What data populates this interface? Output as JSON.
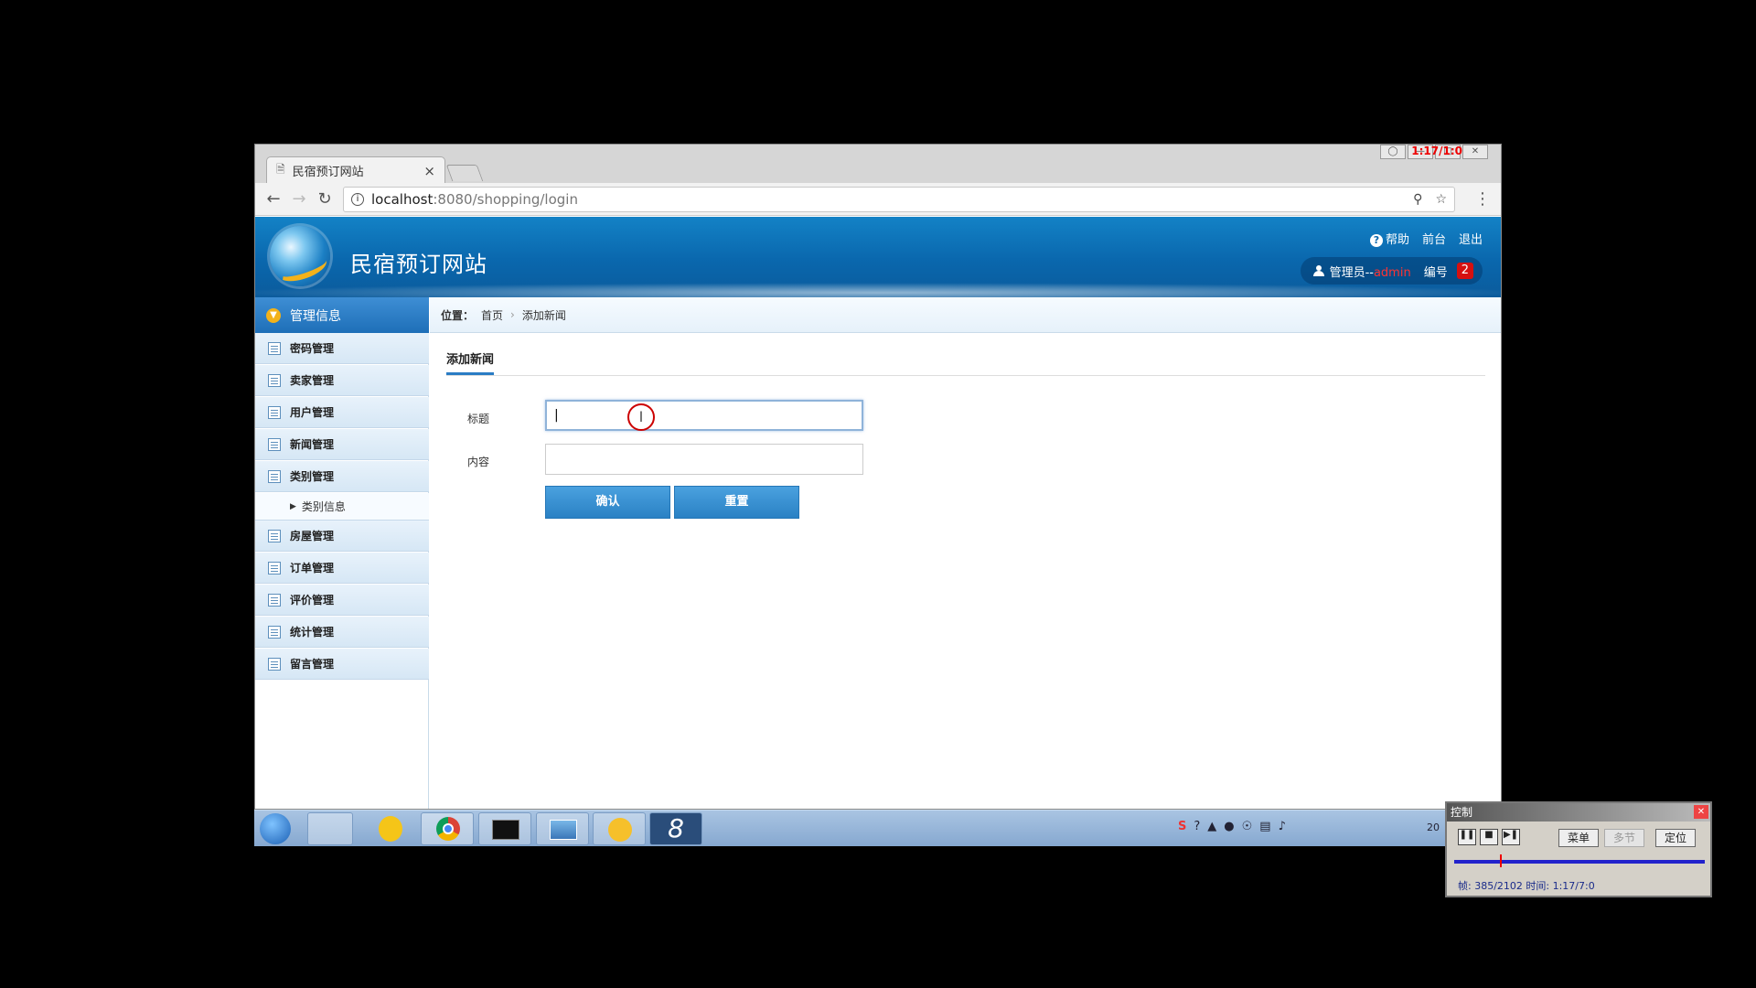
{
  "browser": {
    "tab_title": "民宿预订网站",
    "tab_close": "×",
    "url_host": "localhost",
    "url_path": ":8080/shopping/login",
    "overlay_text": "1:17/1:0"
  },
  "header": {
    "site_name": "民宿预订网站",
    "help": "帮助",
    "front": "前台",
    "logout": "退出",
    "user_prefix": "管理员--",
    "user_name": "admin",
    "id_label": "编号",
    "id_value": "2"
  },
  "sidebar": {
    "title": "管理信息",
    "items": [
      {
        "label": "密码管理"
      },
      {
        "label": "卖家管理"
      },
      {
        "label": "用户管理"
      },
      {
        "label": "新闻管理"
      },
      {
        "label": "类别管理"
      },
      {
        "label": "房屋管理"
      },
      {
        "label": "订单管理"
      },
      {
        "label": "评价管理"
      },
      {
        "label": "统计管理"
      },
      {
        "label": "留言管理"
      }
    ],
    "sub_item": "类别信息"
  },
  "breadcrumb": {
    "label": "位置：",
    "home": "首页",
    "current": "添加新闻"
  },
  "form": {
    "heading": "添加新闻",
    "title_label": "标题",
    "title_value": "|",
    "content_label": "内容",
    "content_value": "",
    "confirm": "确认",
    "reset": "重置"
  },
  "taskbar": {
    "clock_fragment": "20"
  },
  "control_panel": {
    "title": "控制",
    "menu": "菜单",
    "multi": "多节",
    "locate": "定位",
    "status": "帧: 385/2102 时间: 1:17/7:0"
  }
}
